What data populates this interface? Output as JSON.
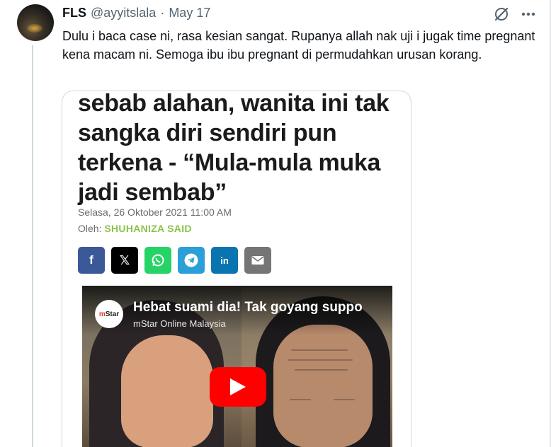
{
  "tweet": {
    "name": "FLS",
    "handle": "@ayyitslala",
    "separator": "·",
    "date": "May 17",
    "text": "Dulu i baca case ni, rasa kesian sangat. Rupanya allah nak uji i jugak time pregnant kena macam ni. Semoga ibu ibu pregnant di permudahkan urusan korang.",
    "icons": {
      "grok": "grok-icon",
      "more": "more-icon"
    }
  },
  "article": {
    "headline": "sebab alahan, wanita ini tak sangka diri sendiri pun terkena - “Mula-mula muka jadi sembab”",
    "date": "Selasa, 26 Oktober 2021 11:00 AM",
    "byline_prefix": "Oleh: ",
    "author": "SHUHANIZA SAID",
    "share_buttons": [
      {
        "icon": "facebook-icon",
        "glyph": "f",
        "color": "#3b5998"
      },
      {
        "icon": "x-icon",
        "glyph": "𝕏",
        "color": "#000000"
      },
      {
        "icon": "whatsapp-icon",
        "color": "#25d366"
      },
      {
        "icon": "telegram-icon",
        "color": "#2a9fd8"
      },
      {
        "icon": "linkedin-icon",
        "glyph": "in",
        "color": "#0a74b1"
      },
      {
        "icon": "email-icon",
        "color": "#757575"
      }
    ]
  },
  "video": {
    "title": "Hebat suami dia! Tak goyang suppo",
    "channel": "mStar Online Malaysia",
    "logo_text_m": "m",
    "logo_text_rest": "Star"
  },
  "colors": {
    "author_green": "#8bc34a",
    "youtube_red": "#ff0000",
    "text_secondary": "#536471"
  }
}
